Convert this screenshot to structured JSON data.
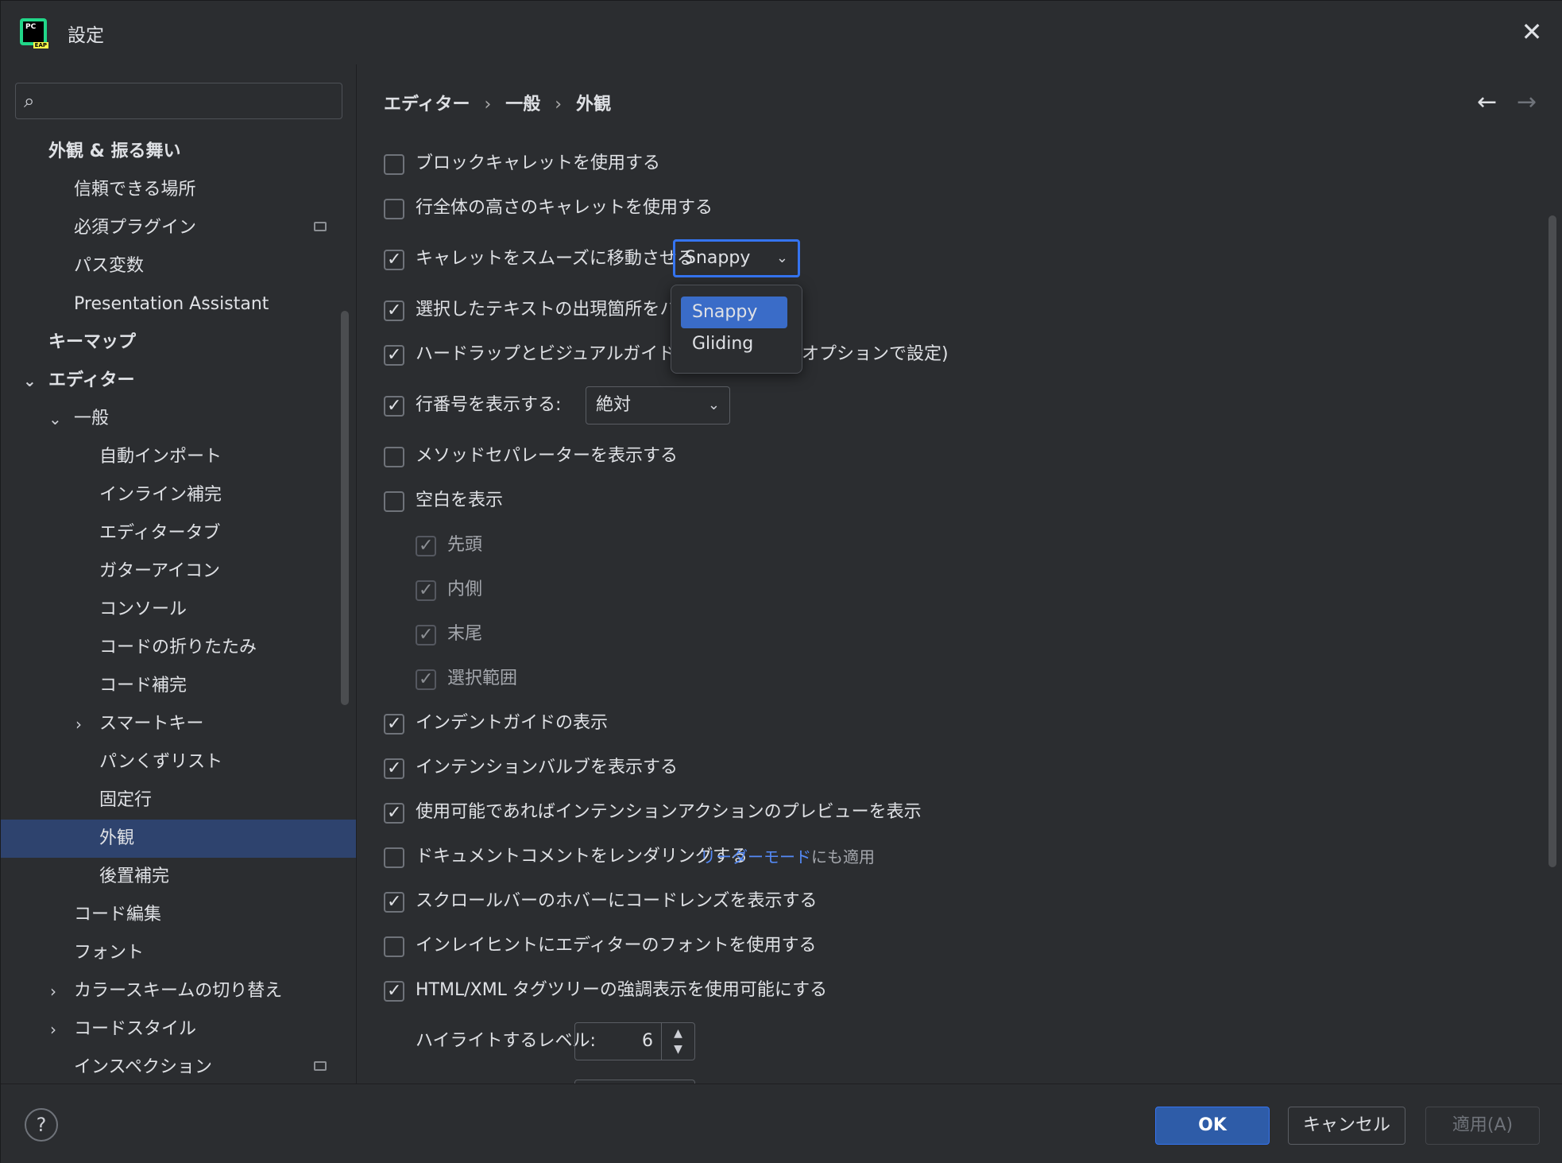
{
  "window": {
    "title": "設定",
    "app_icon_text": "PC",
    "app_icon_badge": "EAP"
  },
  "sidebar": {
    "search_placeholder": "",
    "items": [
      {
        "label": "外観 & 振る舞い"
      },
      {
        "label": "信頼できる場所"
      },
      {
        "label": "必須プラグイン"
      },
      {
        "label": "パス変数"
      },
      {
        "label": "Presentation Assistant"
      },
      {
        "label": "キーマップ"
      },
      {
        "label": "エディター"
      },
      {
        "label": "一般"
      },
      {
        "label": "自動インポート"
      },
      {
        "label": "インライン補完"
      },
      {
        "label": "エディタータブ"
      },
      {
        "label": "ガターアイコン"
      },
      {
        "label": "コンソール"
      },
      {
        "label": "コードの折りたたみ"
      },
      {
        "label": "コード補完"
      },
      {
        "label": "スマートキー"
      },
      {
        "label": "パンくずリスト"
      },
      {
        "label": "固定行"
      },
      {
        "label": "外観"
      },
      {
        "label": "後置補完"
      },
      {
        "label": "コード編集"
      },
      {
        "label": "フォント"
      },
      {
        "label": "カラースキームの切り替え"
      },
      {
        "label": "コードスタイル"
      },
      {
        "label": "インスペクション"
      }
    ]
  },
  "breadcrumb": {
    "part1": "エディター",
    "part2": "一般",
    "part3": "外観",
    "sep": "›"
  },
  "options": {
    "block_caret": {
      "label": "ブロックキャレットを使用する",
      "checked": false
    },
    "full_line_caret": {
      "label": "行全体の高さのキャレットを使用する",
      "checked": false
    },
    "smooth_caret": {
      "label": "キャレットをスムーズに移動させる",
      "checked": true,
      "combo_value": "Snappy"
    },
    "highlight_selection": {
      "label": "選択したテキストの出現箇所をハイ",
      "checked": true
    },
    "hard_wrap": {
      "label": "ハードラップとビジュアルガイドを表示",
      "suffix": "オプションで設定)",
      "checked": true
    },
    "line_numbers": {
      "label": "行番号を表示する:",
      "checked": true,
      "combo_value": "絶対"
    },
    "method_separators": {
      "label": "メソッドセパレーターを表示する",
      "checked": false
    },
    "whitespace": {
      "label": "空白を表示",
      "checked": false
    },
    "ws_leading": {
      "label": "先頭",
      "checked": true
    },
    "ws_inner": {
      "label": "内側",
      "checked": true
    },
    "ws_trailing": {
      "label": "末尾",
      "checked": true
    },
    "ws_selection": {
      "label": "選択範囲",
      "checked": true
    },
    "indent_guides": {
      "label": "インデントガイドの表示",
      "checked": true
    },
    "intention_bulb": {
      "label": "インテンションバルブを表示する",
      "checked": true
    },
    "intention_preview": {
      "label": "使用可能であればインテンションアクションのプレビューを表示",
      "checked": true
    },
    "render_doc": {
      "label": "ドキュメントコメントをレンダリングする",
      "link": "リーダーモード",
      "link_suffix": "にも適用",
      "checked": false
    },
    "code_lens": {
      "label": "スクロールバーのホバーにコードレンズを表示する",
      "checked": true
    },
    "inlay_font": {
      "label": "インレイヒントにエディターのフォントを使用する",
      "checked": false
    },
    "html_tag_tree": {
      "label": "HTML/XML タグツリーの強調表示を使用可能にする",
      "checked": true
    },
    "highlight_level": {
      "label": "ハイライトするレベル:",
      "value": "6"
    }
  },
  "caret_dropdown": {
    "items": [
      "Snappy",
      "Gliding"
    ],
    "selected": "Snappy"
  },
  "footer": {
    "help": "?",
    "ok": "OK",
    "cancel": "キャンセル",
    "apply": "適用(A)"
  }
}
